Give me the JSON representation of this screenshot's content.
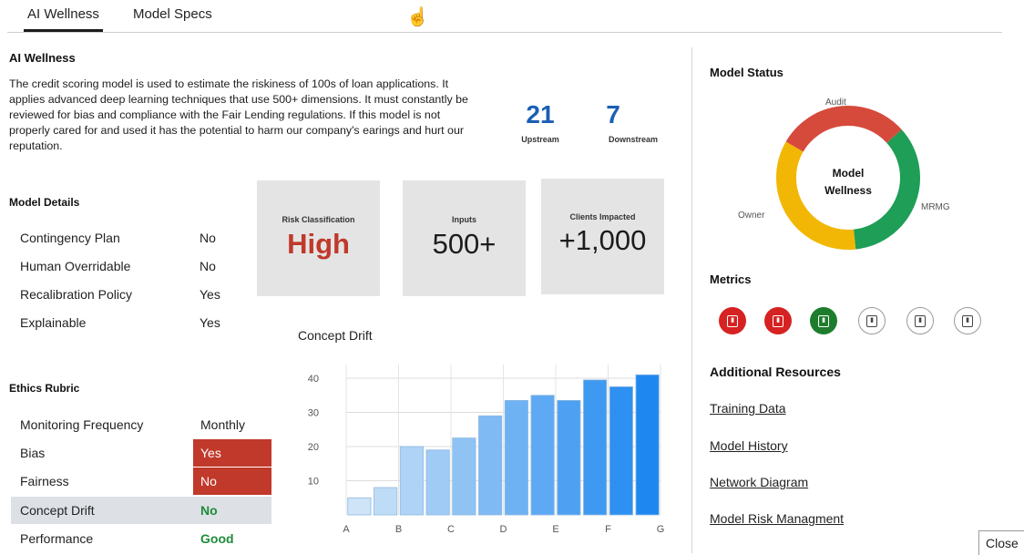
{
  "tabs": [
    {
      "label": "AI Wellness",
      "active": true
    },
    {
      "label": "Model Specs",
      "active": false
    }
  ],
  "overview": {
    "title": "AI Wellness",
    "description": "The credit scoring model is used to estimate the riskiness of 100s of loan applications. It applies advanced deep learning techniques that use 500+ dimensions. It must constantly be reviewed for bias and compliance with the Fair Lending regulations. If this model is not properly cared for and used it has the potential to harm our company's earings and hurt our reputation."
  },
  "dependencies": {
    "upstream": {
      "value": "21",
      "label": "Upstream"
    },
    "downstream": {
      "value": "7",
      "label": "Downstream"
    }
  },
  "model_details": {
    "title": "Model Details",
    "rows": [
      {
        "label": "Contingency Plan",
        "value": "No"
      },
      {
        "label": "Human Overridable",
        "value": "No"
      },
      {
        "label": "Recalibration Policy",
        "value": "Yes"
      },
      {
        "label": "Explainable",
        "value": "Yes"
      }
    ]
  },
  "cards": [
    {
      "title": "Risk Classification",
      "value": "High"
    },
    {
      "title": "Inputs",
      "value": "500+"
    },
    {
      "title": "Clients Impacted",
      "value": "+1,000"
    }
  ],
  "ethics_rubric": {
    "title": "Ethics Rubric",
    "rows": [
      {
        "label": "Monitoring Frequency",
        "value": "Monthly",
        "status": "neutral"
      },
      {
        "label": "Bias",
        "value": "Yes",
        "status": "bad"
      },
      {
        "label": "Fairness",
        "value": "No",
        "status": "bad"
      },
      {
        "label": "Concept Drift",
        "value": "No",
        "status": "good"
      },
      {
        "label": "Performance",
        "value": "Good",
        "status": "good"
      }
    ]
  },
  "chart_data": {
    "type": "bar",
    "title": "Concept Drift",
    "xlabel": "",
    "ylabel": "",
    "x_ticks": [
      "A",
      "B",
      "C",
      "D",
      "E",
      "F",
      "G"
    ],
    "values": [
      5,
      8,
      20,
      19,
      22.5,
      29,
      33.5,
      35,
      33.5,
      39.5,
      37.5,
      41
    ],
    "yticks": [
      10,
      20,
      30,
      40
    ],
    "ylim": [
      0,
      44
    ],
    "grid": true,
    "colors": {
      "low": "#cfe4f7",
      "high": "#1e88f0",
      "border": "#8fb8e0"
    }
  },
  "model_status": {
    "title": "Model Status",
    "center_line1": "Model",
    "center_line2": "Wellness",
    "segments": [
      {
        "label": "Audit",
        "color": "#d64a3b",
        "value": 0.3
      },
      {
        "label": "MRMG",
        "color": "#1e9e57",
        "value": 0.35
      },
      {
        "label": "Owner",
        "color": "#f2b705",
        "value": 0.35
      }
    ]
  },
  "metrics": {
    "title": "Metrics",
    "items": [
      {
        "status": "red"
      },
      {
        "status": "red"
      },
      {
        "status": "green"
      },
      {
        "status": "outline"
      },
      {
        "status": "outline"
      },
      {
        "status": "outline"
      }
    ]
  },
  "resources": {
    "title": "Additional Resources",
    "links": [
      "Training Data",
      "Model History",
      "Network Diagram",
      "Model Risk Managment"
    ]
  },
  "close_label": "Close"
}
